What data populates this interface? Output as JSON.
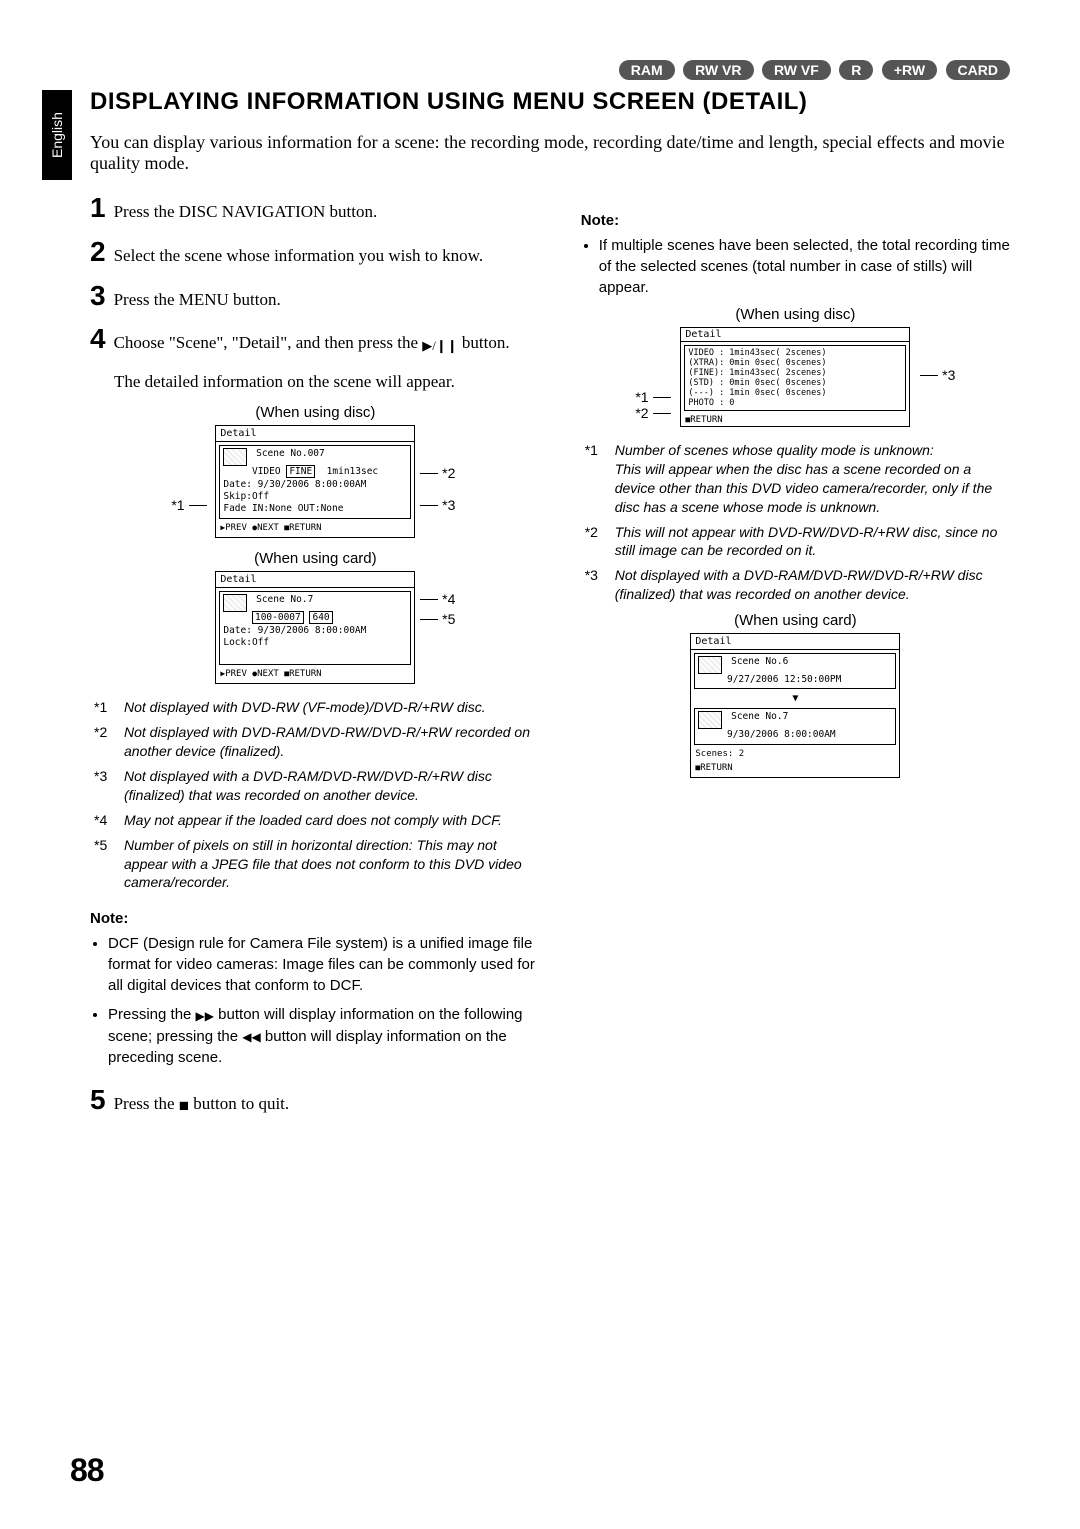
{
  "tab": "English",
  "media_tags": [
    "RAM",
    "RW VR",
    "RW VF",
    "R",
    "+RW",
    "CARD"
  ],
  "heading": "DISPLAYING INFORMATION USING MENU SCREEN (DETAIL)",
  "intro": "You can display various information for a scene: the recording mode, recording date/time and length, special effects and movie quality mode.",
  "steps": {
    "s1": "Press the DISC NAVIGATION button.",
    "s2": "Select the scene whose information you wish to know.",
    "s3": "Press the MENU button.",
    "s4a": "Choose \"Scene\", \"Detail\", and then press the ",
    "s4b": " button.",
    "s4_sub": "The detailed information on the scene will appear.",
    "s5a": "Press the ",
    "s5b": " button to quit."
  },
  "diag_disc": {
    "caption": "(When using disc)",
    "header": "Detail",
    "scene": "Scene No.007",
    "video": "VIDEO",
    "mode": "FINE",
    "len": "1min13sec",
    "date": "Date: 9/30/2006  8:00:00AM",
    "skip": "Skip:Off",
    "fade": "Fade IN:None OUT:None",
    "footer_prev": "PREV",
    "footer_next": "NEXT",
    "footer_return": "RETURN",
    "a1": "*1",
    "a2": "*2",
    "a3": "*3"
  },
  "diag_card": {
    "caption": "(When using card)",
    "header": "Detail",
    "scene": "Scene No.7",
    "code": "100-0007",
    "px": "640",
    "date": "Date: 9/30/2006  8:00:00AM",
    "lock": "Lock:Off",
    "a4": "*4",
    "a5": "*5"
  },
  "footnotes_left": [
    {
      "k": "*1",
      "t": "Not displayed with DVD-RW (VF-mode)/DVD-R/+RW disc."
    },
    {
      "k": "*2",
      "t": "Not displayed with DVD-RAM/DVD-RW/DVD-R/+RW recorded on another device (finalized)."
    },
    {
      "k": "*3",
      "t": "Not displayed with a DVD-RAM/DVD-RW/DVD-R/+RW disc (finalized) that was recorded on another device."
    },
    {
      "k": "*4",
      "t": "May not appear if the loaded card does not comply with DCF."
    },
    {
      "k": "*5",
      "t": "Number of pixels on still in horizontal direction: This may not appear with a JPEG file that does not conform to this DVD video camera/recorder."
    }
  ],
  "note_left_h": "Note:",
  "note_left": [
    "DCF (Design rule for Camera File system) is a unified image file format for video cameras: Image files can be commonly used for all digital devices that conform to DCF."
  ],
  "note_left_2a": "Pressing the ",
  "note_left_2b": " button will display information on the following scene; pressing the ",
  "note_left_2c": " button will display information on the preceding scene.",
  "note_right_h": "Note:",
  "note_right": "If multiple scenes have been selected, the total recording time of the selected scenes (total number in case of stills) will appear.",
  "diag_multi_disc": {
    "caption": "(When using disc)",
    "header": "Detail",
    "rows": [
      "VIDEO : 1min43sec( 2scenes)",
      "(XTRA): 0min 0sec( 0scenes)",
      "(FINE): 1min43sec( 2scenes)",
      "(STD) : 0min 0sec( 0scenes)",
      "(---) : 1min 0sec( 0scenes)"
    ],
    "photo": "PHOTO : 0",
    "return": "RETURN",
    "a1": "*1",
    "a2": "*2",
    "a3": "*3"
  },
  "footnotes_right": [
    {
      "k": "*1",
      "t": "Number of scenes whose quality mode is unknown:",
      "t2": "This will appear when the disc has a scene recorded on a device other than this DVD video camera/recorder, only if the disc has a scene whose mode is unknown."
    },
    {
      "k": "*2",
      "t": "This will not appear with DVD-RW/DVD-R/+RW disc, since no still image can be recorded on it."
    },
    {
      "k": "*3",
      "t": "Not displayed with a DVD-RAM/DVD-RW/DVD-R/+RW disc (finalized) that was recorded on another device."
    }
  ],
  "diag_multi_card": {
    "caption": "(When using card)",
    "header": "Detail",
    "s6": "Scene No.6",
    "d6": "9/27/2006 12:50:00PM",
    "s7": "Scene No.7",
    "d7": "9/30/2006  8:00:00AM",
    "count": "Scenes: 2",
    "return": "RETURN"
  },
  "page_num": "88"
}
